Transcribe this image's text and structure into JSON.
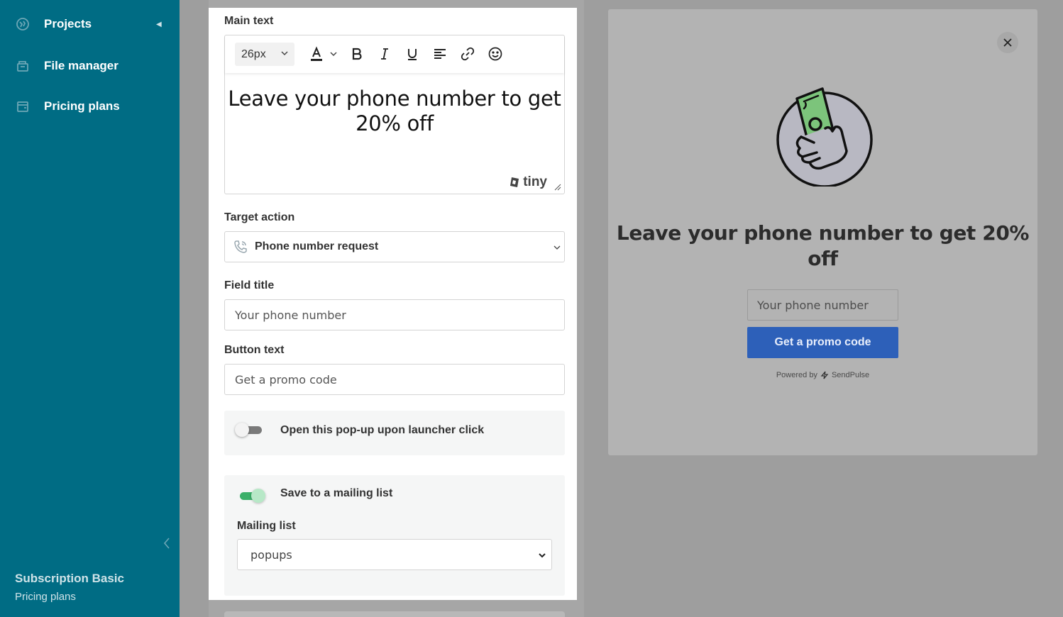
{
  "sidebar": {
    "items": [
      {
        "label": "Projects",
        "icon": "projects-icon"
      },
      {
        "label": "File manager",
        "icon": "file-manager-icon"
      },
      {
        "label": "Pricing plans",
        "icon": "wallet-icon"
      }
    ],
    "plan_name": "Subscription Basic",
    "plan_link": "Pricing plans"
  },
  "form": {
    "main_text_label": "Main text",
    "editor": {
      "font_size": "26px",
      "content": "Leave your phone number to get 20% off",
      "brand": "tiny"
    },
    "target_action_label": "Target action",
    "target_action_value": "Phone number request",
    "field_title_label": "Field title",
    "field_title_value": "Your phone number",
    "button_text_label": "Button text",
    "button_text_value": "Get a promo code",
    "launcher_toggle_label": "Open this pop-up upon launcher click",
    "launcher_toggle_on": false,
    "mailing_toggle_label": "Save to a mailing list",
    "mailing_toggle_on": true,
    "mailing_list_label": "Mailing list",
    "mailing_list_value": "popups"
  },
  "preview": {
    "heading": "Leave your phone number to get 20% off",
    "input_placeholder": "Your phone number",
    "button_label": "Get a promo code",
    "powered_by": "Powered by",
    "brand": "SendPulse"
  },
  "colors": {
    "sidebar": "#006c84",
    "toggle_on": "#3cb06a",
    "preview_button": "#2d60b9"
  }
}
